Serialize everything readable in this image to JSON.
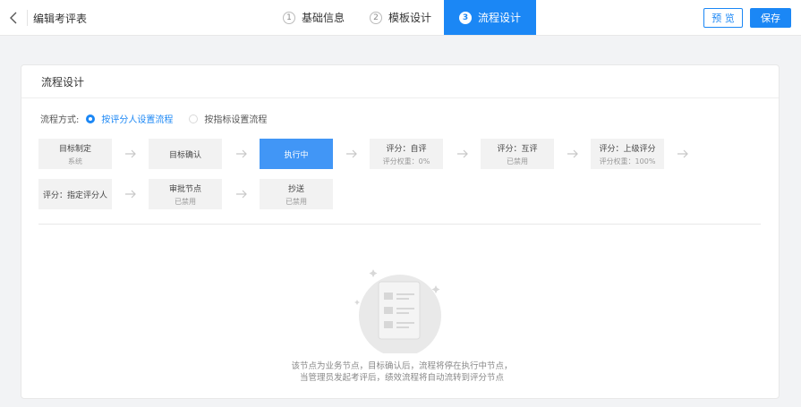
{
  "header": {
    "title": "编辑考评表",
    "steps": [
      {
        "num": "1",
        "label": "基础信息"
      },
      {
        "num": "2",
        "label": "模板设计"
      },
      {
        "num": "3",
        "label": "流程设计"
      }
    ],
    "preview_label": "预 览",
    "save_label": "保存",
    "active_step": 2
  },
  "card": {
    "title": "流程设计",
    "mode_label": "流程方式:",
    "modes": [
      {
        "label": "按评分人设置流程",
        "checked": true
      },
      {
        "label": "按指标设置流程",
        "checked": false
      }
    ],
    "nodes": [
      {
        "name": "目标制定",
        "sub": "系统"
      },
      {
        "name": "目标确认",
        "sub": ""
      },
      {
        "name": "执行中",
        "sub": "",
        "active": true
      },
      {
        "name": "评分：自评",
        "sub": "评分权重：0%"
      },
      {
        "name": "评分：互评",
        "sub": "已禁用"
      },
      {
        "name": "评分：上级评分",
        "sub": "评分权重：100%"
      },
      {
        "name": "评分：指定评分人",
        "sub": ""
      },
      {
        "name": "审批节点",
        "sub": "已禁用"
      },
      {
        "name": "抄送",
        "sub": "已禁用"
      }
    ],
    "empty_text_1": "该节点为业务节点，目标确认后，流程将停在执行中节点，",
    "empty_text_2": "当管理员发起考评后，绩效流程将自动流转到评分节点"
  },
  "colors": {
    "accent": "#1b87f5",
    "active_node": "#4196f6",
    "node_bg": "#f2f2f2"
  },
  "icons": [
    "back-arrow-icon",
    "right-arrow-icon",
    "document-illustration-icon"
  ]
}
